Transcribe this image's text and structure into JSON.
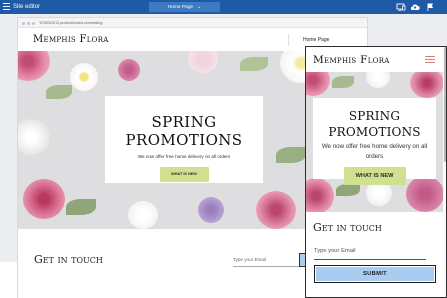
{
  "editor": {
    "title": "Site editor",
    "current_page": "Home Page",
    "icons": [
      "menu-icon",
      "chevron-down-icon",
      "device-preview-icon",
      "cloud-upload-icon",
      "flag-icon"
    ]
  },
  "browser": {
    "url": "YEDINGE13.prodecthosted.com/testing"
  },
  "site": {
    "brand": "Memphis Flora",
    "nav": [
      "Home Page"
    ],
    "hero": {
      "title": "SPRING PROMOTIONS",
      "subtitle": "We now offer free home delivery on all orders",
      "button": "WHAT IS NEW"
    },
    "contact": {
      "title": "Get in touch",
      "email_placeholder": "Type your Email",
      "submit": "SUBMIT"
    }
  },
  "colors": {
    "topbar": "#1e5aa5",
    "page_selector": "#3e7ac2",
    "workspace": "#ebedf0",
    "promo_button": "#cfe18e",
    "submit_button": "#a8cdf1",
    "hamburger": "#e07f7f"
  }
}
